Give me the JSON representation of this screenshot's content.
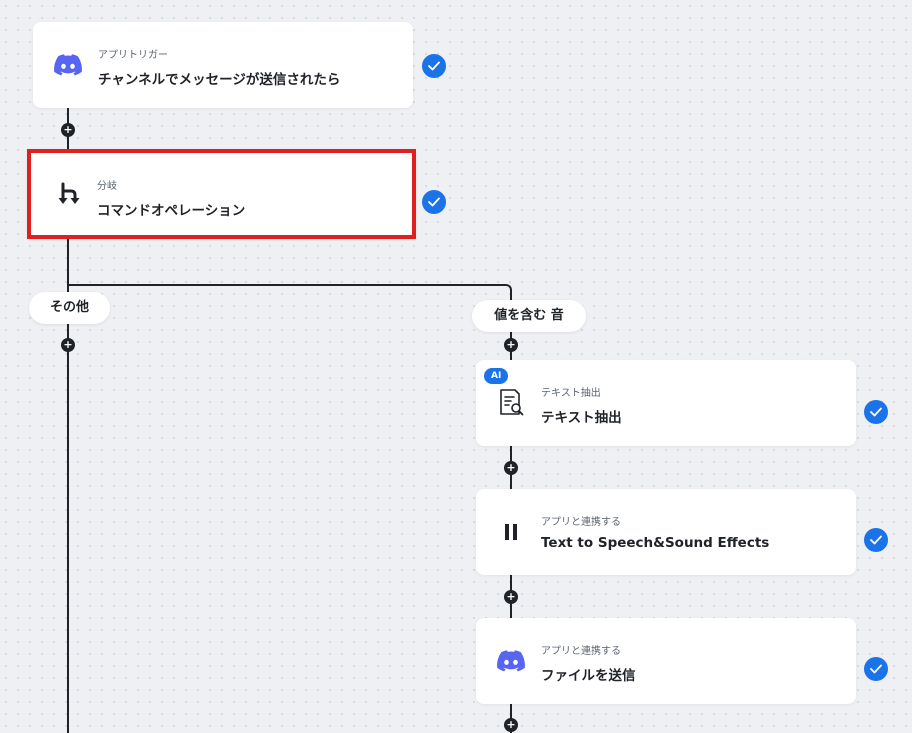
{
  "colors": {
    "accent": "#1a73e8",
    "highlight": "#e01f1f",
    "discord": "#5865f2",
    "line": "#1f2328"
  },
  "nodes": [
    {
      "subtitle": "アプリトリガー",
      "title": "チャンネルでメッセージが送信されたら",
      "icon": "discord-icon",
      "status": "complete"
    },
    {
      "subtitle": "分岐",
      "title": "コマンドオペレーション",
      "icon": "branch-icon",
      "status": "complete",
      "selected": true
    },
    {
      "subtitle": "テキスト抽出",
      "title": "テキスト抽出",
      "icon": "document-search-icon",
      "badge": "AI",
      "status": "complete"
    },
    {
      "subtitle": "アプリと連携する",
      "title": "Text to Speech&Sound Effects",
      "icon": "pause-icon",
      "status": "complete"
    },
    {
      "subtitle": "アプリと連携する",
      "title": "ファイルを送信",
      "icon": "discord-icon",
      "status": "complete"
    }
  ],
  "branches": {
    "left": "その他",
    "right": "値を含む 音"
  },
  "add_button_glyph": "+"
}
